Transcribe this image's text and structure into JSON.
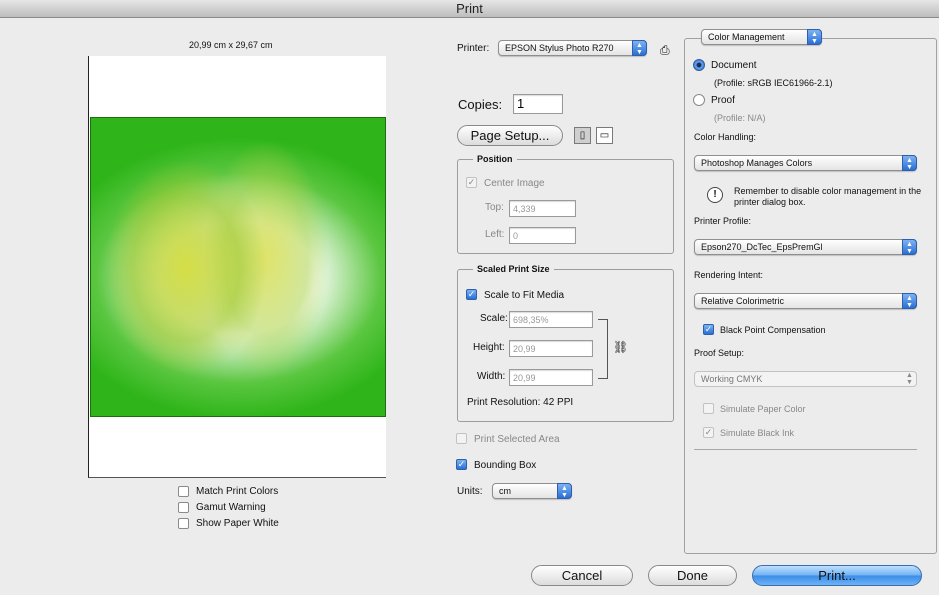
{
  "window": {
    "title": "Print"
  },
  "preview": {
    "size_label": "20,99 cm x 29,67 cm",
    "options": [
      {
        "label": "Match Print Colors",
        "checked": false
      },
      {
        "label": "Gamut Warning",
        "checked": false
      },
      {
        "label": "Show Paper White",
        "checked": false
      }
    ]
  },
  "printer": {
    "label": "Printer:",
    "value": "EPSON Stylus Photo R270"
  },
  "copies": {
    "label": "Copies:",
    "value": "1"
  },
  "page_setup": {
    "label": "Page Setup..."
  },
  "position": {
    "title": "Position",
    "center_image": {
      "label": "Center Image",
      "checked": true
    },
    "top": {
      "label": "Top:",
      "value": "4,339"
    },
    "left": {
      "label": "Left:",
      "value": "0"
    }
  },
  "scaled": {
    "title": "Scaled Print Size",
    "scale_to_fit": {
      "label": "Scale to Fit Media",
      "checked": true
    },
    "scale": {
      "label": "Scale:",
      "value": "698,35%"
    },
    "height": {
      "label": "Height:",
      "value": "20,99"
    },
    "width": {
      "label": "Width:",
      "value": "20,99"
    },
    "resolution": "Print Resolution: 42 PPI"
  },
  "print_selected_area": {
    "label": "Print Selected Area",
    "checked": false
  },
  "bounding_box": {
    "label": "Bounding Box",
    "checked": true
  },
  "units": {
    "label": "Units:",
    "value": "cm"
  },
  "color_mgmt": {
    "section": "Color Management",
    "document": {
      "label": "Document",
      "profile": "(Profile: sRGB IEC61966-2.1)"
    },
    "proof": {
      "label": "Proof",
      "profile": "(Profile: N/A)"
    },
    "color_handling_label": "Color Handling:",
    "color_handling": "Photoshop Manages Colors",
    "warning": "Remember to disable color management in the printer dialog box.",
    "printer_profile_label": "Printer Profile:",
    "printer_profile": "Epson270_DcTec_EpsPremGl",
    "rendering_intent_label": "Rendering Intent:",
    "rendering_intent": "Relative Colorimetric",
    "black_point": {
      "label": "Black Point Compensation",
      "checked": true
    },
    "proof_setup_label": "Proof Setup:",
    "proof_setup": "Working CMYK",
    "simulate_paper": {
      "label": "Simulate Paper Color",
      "checked": false
    },
    "simulate_ink": {
      "label": "Simulate Black Ink",
      "checked": true
    }
  },
  "buttons": {
    "cancel": "Cancel",
    "done": "Done",
    "print": "Print..."
  },
  "colors": {
    "accent": "#2a6fd6",
    "image_green": "#2fb51a",
    "window_bg": "#ececec"
  }
}
